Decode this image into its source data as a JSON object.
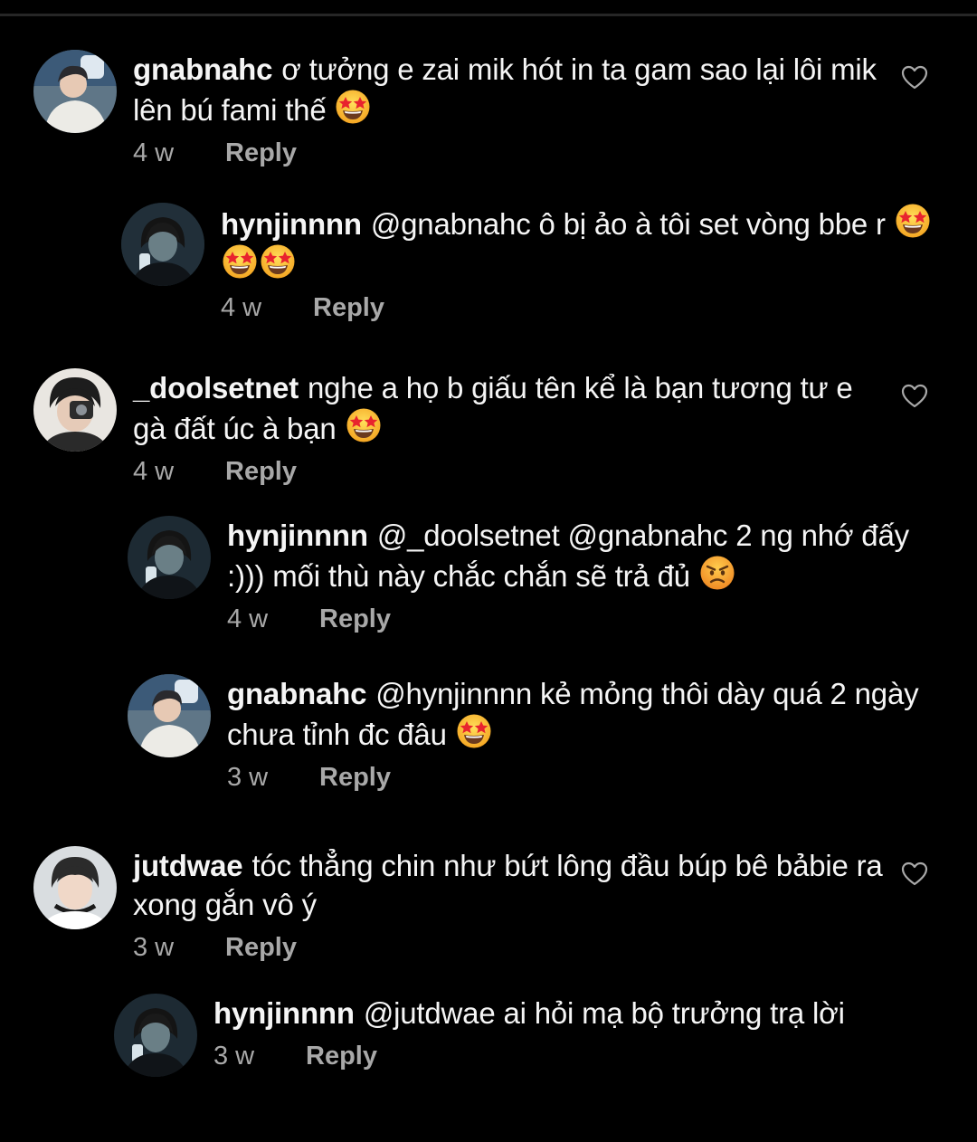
{
  "colors": {
    "background": "#000000",
    "text": "#f5f5f5",
    "secondary": "#a8a8a8",
    "divider": "#262626"
  },
  "icons": {
    "like": "heart-outline-icon",
    "emoji_star": "star-struck-emoji",
    "emoji_angry": "angry-face-emoji"
  },
  "comments": [
    {
      "username": "gnabnahc",
      "text_before": "ơ tưởng e zai mik hót in ta gam sao lại lôi mik lên bú fami thế",
      "time": "4 w",
      "reply_label": "Reply"
    },
    {
      "username": "hynjinnnn",
      "text_before": "@gnabnahc ô bị ảo à tôi set vòng bbe r",
      "time": "4 w",
      "reply_label": "Reply"
    },
    {
      "username": "_doolsetnet",
      "text_before": "nghe a họ b giấu tên kể là bạn tương tư e gà đất úc à bạn",
      "time": "4 w",
      "reply_label": "Reply"
    },
    {
      "username": "hynjinnnn",
      "text_before": "@_doolsetnet @gnabnahc 2 ng nhớ đấy :))) mối thù này chắc chắn sẽ trả đủ",
      "time": "4 w",
      "reply_label": "Reply"
    },
    {
      "username": "gnabnahc",
      "text_before": "@hynjinnnn kẻ mỏng thôi dày quá 2 ngày chưa tỉnh đc đâu",
      "time": "3 w",
      "reply_label": "Reply"
    },
    {
      "username": "jutdwae",
      "text_before": "tóc thẳng chin như bứt lông đầu búp bê bảbie ra xong gắn vô ý",
      "time": "3 w",
      "reply_label": "Reply"
    },
    {
      "username": "hynjinnnn",
      "text_before": "@jutdwae ai hỏi mạ bộ trưởng trạ lời",
      "time": "3 w",
      "reply_label": "Reply"
    }
  ]
}
